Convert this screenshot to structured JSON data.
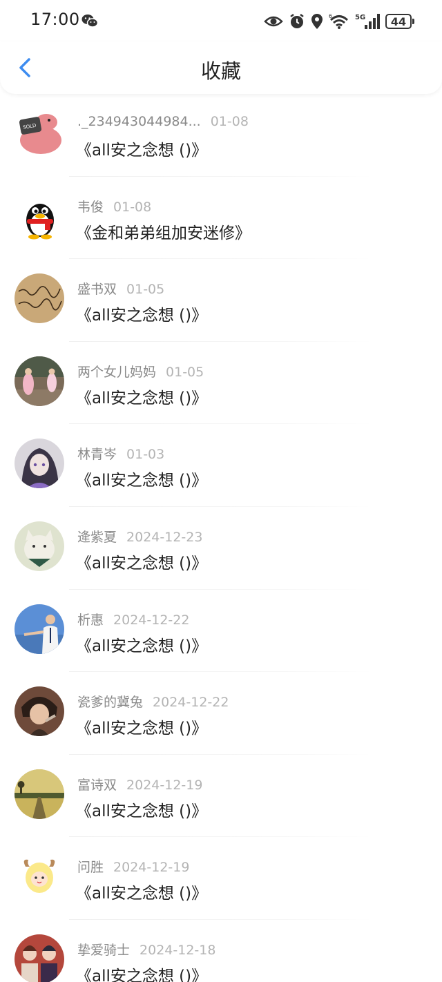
{
  "status_bar": {
    "time": "17:00",
    "network": "5G",
    "battery": "44"
  },
  "header": {
    "title": "收藏"
  },
  "items": [
    {
      "user": "._234943044984...",
      "date": "01-08",
      "book": "《all安之念想 ()》",
      "avatar": "pink-pig-avatar"
    },
    {
      "user": "韦俊",
      "date": "01-08",
      "book": "《金和弟弟组加安迷修》",
      "avatar": "qq-penguin-avatar"
    },
    {
      "user": "盛书双",
      "date": "01-05",
      "book": "《all安之念想 ()》",
      "avatar": "handwriting-avatar"
    },
    {
      "user": "两个女儿妈妈",
      "date": "01-05",
      "book": "《all安之念想 ()》",
      "avatar": "photo-girls-avatar"
    },
    {
      "user": "林青岑",
      "date": "01-03",
      "book": "《all安之念想 ()》",
      "avatar": "anime-girl-avatar"
    },
    {
      "user": "逄紫夏",
      "date": "2024-12-23",
      "book": "《all安之念想 ()》",
      "avatar": "cat-avatar"
    },
    {
      "user": "析惠",
      "date": "2024-12-22",
      "book": "《all安之念想 ()》",
      "avatar": "man-photo-avatar"
    },
    {
      "user": "瓷爹的冀兔",
      "date": "2024-12-22",
      "book": "《all安之念想 ()》",
      "avatar": "anime-boy-avatar"
    },
    {
      "user": "富诗双",
      "date": "2024-12-19",
      "book": "《all安之念想 ()》",
      "avatar": "landscape-avatar"
    },
    {
      "user": "问胜",
      "date": "2024-12-19",
      "book": "《all安之念想 ()》",
      "avatar": "chick-avatar"
    },
    {
      "user": "挚爱骑士",
      "date": "2024-12-18",
      "book": "《all安之念想 ()》",
      "avatar": "anime-group-avatar"
    }
  ],
  "colors": {
    "accent": "#3d8cf0",
    "meta_text": "#8a8a8a",
    "date_text": "#b4b4b4"
  }
}
